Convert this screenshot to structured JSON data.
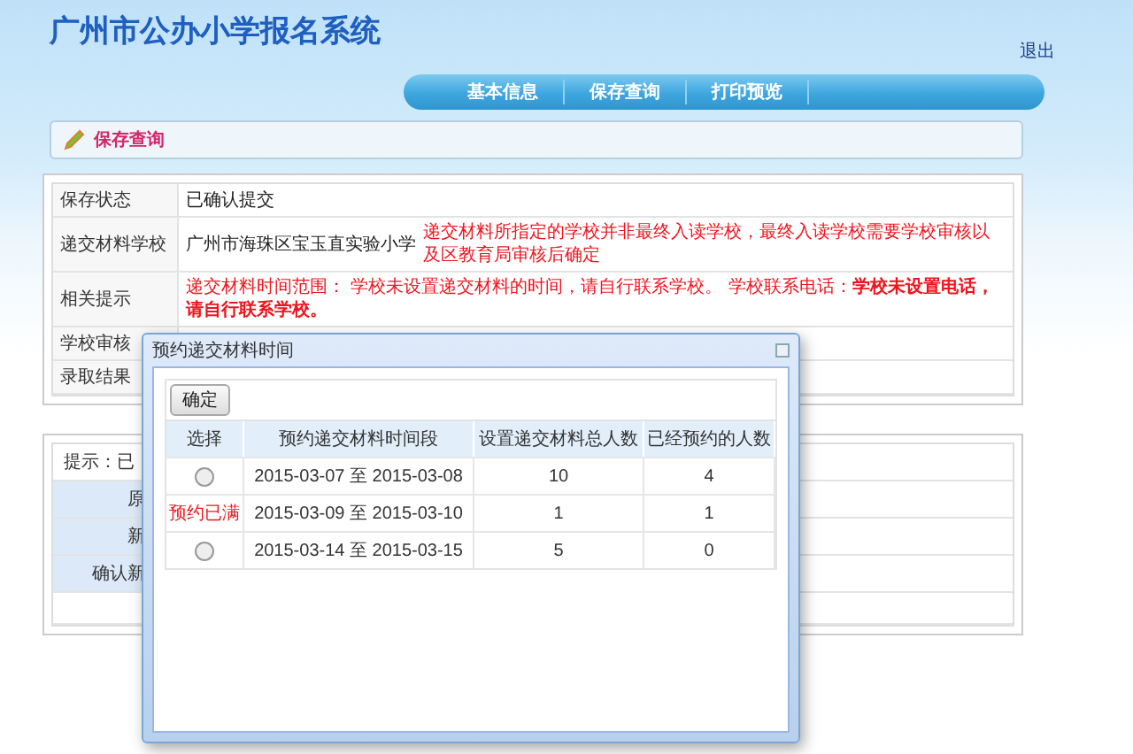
{
  "header": {
    "title": "广州市公办小学报名系统",
    "logout": "退出"
  },
  "nav": {
    "items": [
      "基本信息",
      "保存查询",
      "打印预览"
    ]
  },
  "breadcrumb": {
    "label": "保存查询"
  },
  "info": {
    "rows": [
      {
        "label": "保存状态",
        "value": "已确认提交"
      },
      {
        "label": "递交材料学校",
        "value": "广州市海珠区宝玉直实验小学",
        "note": "递交材料所指定的学校并非最终入读学校，最终入读学校需要学校审核以及区教育局审核后确定"
      },
      {
        "label": "相关提示",
        "note": "递交材料时间范围： 学校未设置递交材料的时间，请自行联系学校。 学校联系电话：**学校未设置电话，请自行联系学校。**"
      },
      {
        "label": "学校审核"
      },
      {
        "label": "录取结果"
      }
    ]
  },
  "password_panel": {
    "hint": "提示：已",
    "rows": [
      {
        "label": "原"
      },
      {
        "label": "新"
      },
      {
        "label": "确认新"
      }
    ]
  },
  "dialog": {
    "title": "预约递交材料时间",
    "confirm": "确定",
    "columns": [
      "选择",
      "预约递交材料时间段",
      "设置递交材料总人数",
      "已经预约的人数"
    ],
    "rows": [
      {
        "kind": "radio",
        "selected": false,
        "period": "2015-03-07 至 2015-03-08",
        "total": "10",
        "booked": "4"
      },
      {
        "kind": "status",
        "status": "预约已满",
        "period": "2015-03-09 至 2015-03-10",
        "total": "1",
        "booked": "1"
      },
      {
        "kind": "radio",
        "selected": false,
        "period": "2015-03-14 至 2015-03-15",
        "total": "5",
        "booked": "0"
      }
    ]
  }
}
